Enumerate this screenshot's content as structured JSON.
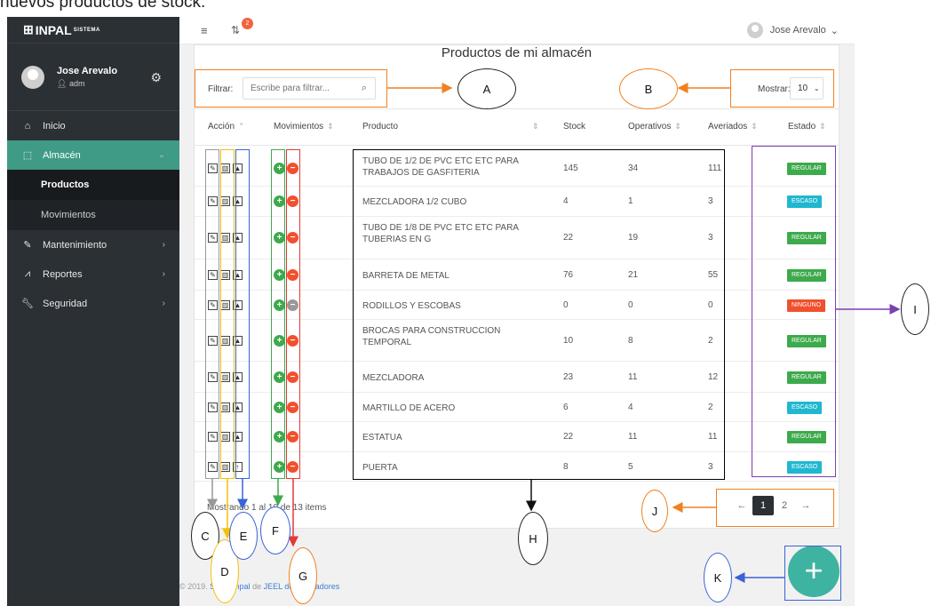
{
  "caption": "nuevos productos de stock.",
  "brand": {
    "name": "INPAL",
    "suffix": "SISTEMA"
  },
  "user": {
    "name": "Jose Arevalo",
    "role": "adm"
  },
  "sidebar": {
    "items": [
      {
        "label": "Inicio",
        "icon": "home-icon"
      },
      {
        "label": "Almacén",
        "icon": "cursor-icon",
        "active": true
      },
      {
        "label": "Mantenimiento",
        "icon": "pencil-icon"
      },
      {
        "label": "Reportes",
        "icon": "chart-icon"
      },
      {
        "label": "Seguridad",
        "icon": "wrench-icon"
      }
    ],
    "subitems": [
      {
        "label": "Productos"
      },
      {
        "label": "Movimientos"
      }
    ]
  },
  "topbar": {
    "notification_count": "2",
    "user_label": "Jose Arevalo"
  },
  "page": {
    "title": "Productos de mi almacén",
    "filter_label": "Filtrar:",
    "filter_placeholder": "Escribe para filtrar...",
    "show_label": "Mostrar:",
    "show_value": "10"
  },
  "table": {
    "headers": [
      "Acción",
      "Movimientos",
      "Producto",
      "Stock",
      "Operativos",
      "Averiados",
      "Estado"
    ],
    "rows": [
      {
        "product": "TUBO DE 1/2 DE PVC ETC ETC PARA TRABAJOS DE GASFITERIA",
        "stock": "145",
        "operativos": "34",
        "averiados": "111",
        "estado": "REGULAR"
      },
      {
        "product": "MEZCLADORA 1/2 CUBO",
        "stock": "4",
        "operativos": "1",
        "averiados": "3",
        "estado": "ESCASO"
      },
      {
        "product": "TUBO DE 1/8 DE PVC ETC ETC PARA TUBERIAS EN G",
        "stock": "22",
        "operativos": "19",
        "averiados": "3",
        "estado": "REGULAR"
      },
      {
        "product": "BARRETA DE METAL",
        "stock": "76",
        "operativos": "21",
        "averiados": "55",
        "estado": "REGULAR"
      },
      {
        "product": "RODILLOS Y ESCOBAS",
        "stock": "0",
        "operativos": "0",
        "averiados": "0",
        "estado": "NINGUNO"
      },
      {
        "product": "BROCAS PARA CONSTRUCCION TEMPORAL",
        "stock": "10",
        "operativos": "8",
        "averiados": "2",
        "estado": "REGULAR"
      },
      {
        "product": "MEZCLADORA",
        "stock": "23",
        "operativos": "11",
        "averiados": "12",
        "estado": "REGULAR"
      },
      {
        "product": "MARTILLO DE ACERO",
        "stock": "6",
        "operativos": "4",
        "averiados": "2",
        "estado": "ESCASO"
      },
      {
        "product": "ESTATUA",
        "stock": "22",
        "operativos": "11",
        "averiados": "11",
        "estado": "REGULAR"
      },
      {
        "product": "PUERTA",
        "stock": "8",
        "operativos": "5",
        "averiados": "3",
        "estado": "ESCASO"
      }
    ]
  },
  "status_colors": {
    "REGULAR": "#3daa4c",
    "ESCASO": "#1fb8d0",
    "NINGUNO": "#f0502e"
  },
  "footer": {
    "info": "Mostrando 1 al 10 de 13 items",
    "pages": [
      "1",
      "2"
    ],
    "copyright": "© 2019.",
    "link1": "STEP|Inpal",
    "between": "de",
    "link2": "JEEL desarrolladores"
  },
  "annotations": [
    "A",
    "B",
    "C",
    "D",
    "E",
    "F",
    "G",
    "H",
    "I",
    "J",
    "K"
  ]
}
